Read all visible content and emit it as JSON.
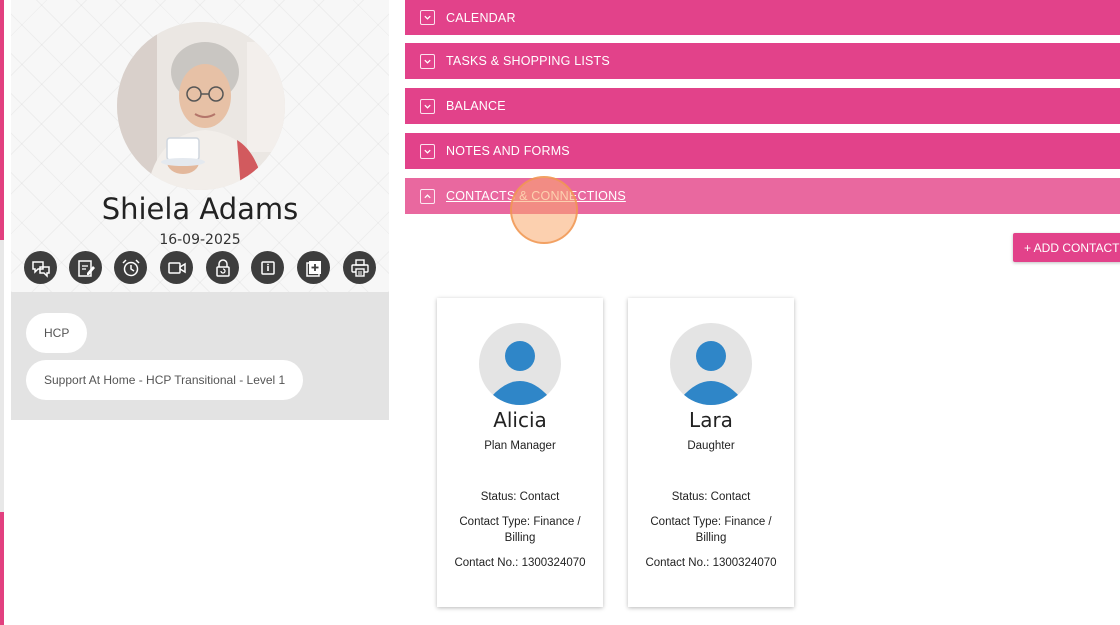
{
  "profile": {
    "name": "Shiela Adams",
    "date": "16-09-2025",
    "actions": [
      {
        "icon": "chat-icon"
      },
      {
        "icon": "edit-note-icon"
      },
      {
        "icon": "alarm-clock-icon"
      },
      {
        "icon": "video-camera-icon"
      },
      {
        "icon": "lock-refresh-icon"
      },
      {
        "icon": "info-icon"
      },
      {
        "icon": "add-document-icon"
      },
      {
        "icon": "print-icon"
      }
    ]
  },
  "tags": [
    "HCP",
    "Support At Home - HCP Transitional - Level 1"
  ],
  "sections": [
    {
      "label": "CALENDAR",
      "expanded": false
    },
    {
      "label": "TASKS & SHOPPING LISTS",
      "expanded": false
    },
    {
      "label": "BALANCE",
      "expanded": false
    },
    {
      "label": "NOTES AND FORMS",
      "expanded": false
    },
    {
      "label": "CONTACTS & CONNECTIONS",
      "expanded": true
    }
  ],
  "add_contact_label": "+ ADD CONTACT",
  "contacts": [
    {
      "name": "Alicia",
      "role": "Plan Manager",
      "status": "Status: Contact",
      "type": "Contact Type: Finance / Billing",
      "phone": "Contact No.: 1300324070"
    },
    {
      "name": "Lara",
      "role": "Daughter",
      "status": "Status: Contact",
      "type": "Contact Type: Finance / Billing",
      "phone": "Contact No.: 1300324070"
    }
  ],
  "colors": {
    "accent": "#e2428a",
    "accent_active": "#e9689f",
    "avatar_blue": "#2f86c8",
    "icon_button": "#3d3d3d"
  }
}
